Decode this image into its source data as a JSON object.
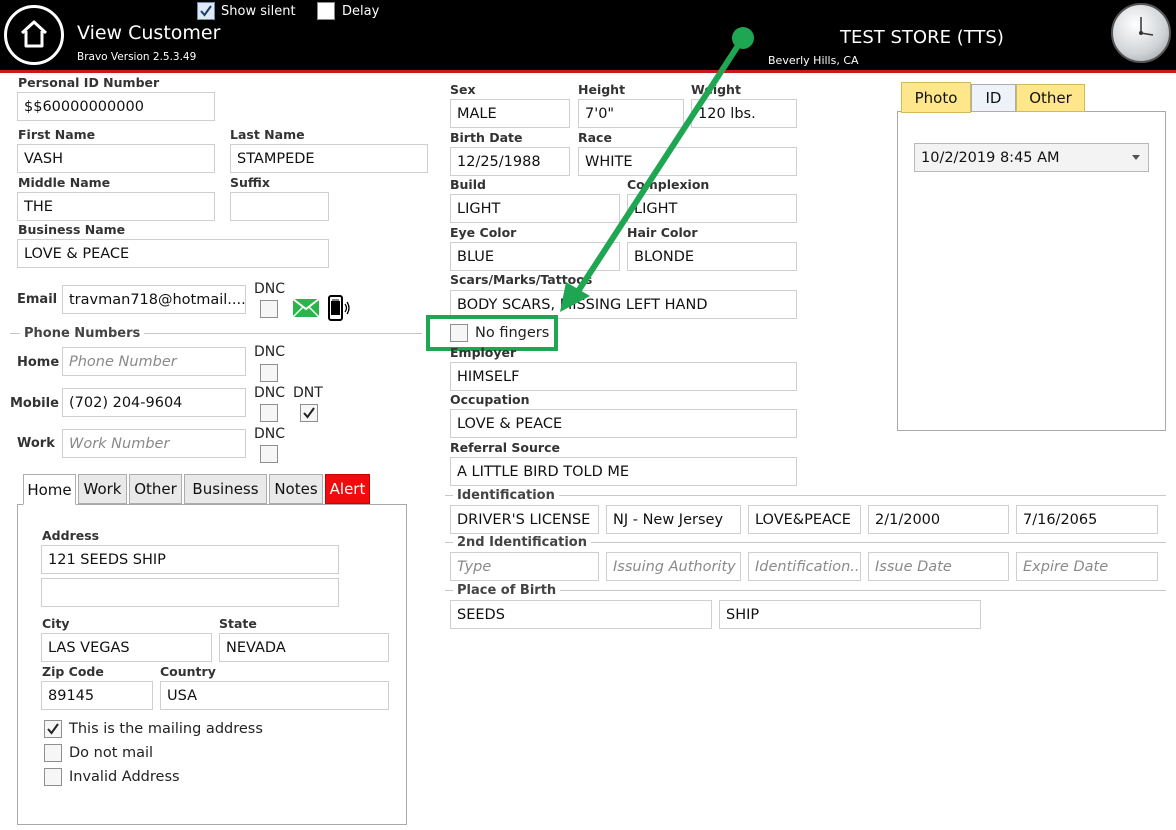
{
  "header": {
    "title": "View Customer",
    "version": "Bravo Version 2.5.3.49",
    "show_silent_label": "Show silent",
    "show_silent_checked": true,
    "delay_label": "Delay",
    "delay_checked": false,
    "store_name": "TEST STORE (TTS)",
    "store_location": "Beverly Hills, CA"
  },
  "personal": {
    "pid_label": "Personal ID Number",
    "pid": "$$60000000000",
    "first_label": "First Name",
    "first": "VASH",
    "last_label": "Last Name",
    "last": "STAMPEDE",
    "middle_label": "Middle Name",
    "middle": "THE",
    "suffix_label": "Suffix",
    "suffix": "",
    "business_label": "Business Name",
    "business": "LOVE & PEACE",
    "email_label": "Email",
    "email": "travman718@hotmail....",
    "dnc_label": "DNC",
    "dnt_label": "DNT"
  },
  "phones": {
    "section_label": "Phone Numbers",
    "home_label": "Home",
    "home_placeholder": "Phone Number",
    "mobile_label": "Mobile",
    "mobile": "(702) 204-9604",
    "work_label": "Work",
    "work_placeholder": "Work Number"
  },
  "address_tabs": [
    "Home",
    "Work",
    "Other",
    "Business",
    "Notes",
    "Alert"
  ],
  "address": {
    "address_label": "Address",
    "line1": "121 SEEDS SHIP",
    "line2": "",
    "city_label": "City",
    "city": "LAS VEGAS",
    "state_label": "State",
    "state": "NEVADA",
    "zip_label": "Zip Code",
    "zip": "89145",
    "country_label": "Country",
    "country": "USA",
    "mailing_label": "This is the mailing address",
    "mailing_checked": true,
    "donotmail_label": "Do not mail",
    "donotmail_checked": false,
    "invalid_label": "Invalid Address",
    "invalid_checked": false
  },
  "physical": {
    "sex_label": "Sex",
    "sex": "MALE",
    "height_label": "Height",
    "height": "7'0\"",
    "weight_label": "Weight",
    "weight": "120 lbs.",
    "birth_label": "Birth Date",
    "birth": "12/25/1988",
    "race_label": "Race",
    "race": "WHITE",
    "build_label": "Build",
    "build": "LIGHT",
    "complexion_label": "Complexion",
    "complexion": "LIGHT",
    "eye_label": "Eye Color",
    "eye": "BLUE",
    "hair_label": "Hair Color",
    "hair": "BLONDE",
    "scars_label": "Scars/Marks/Tattoos",
    "scars": "BODY SCARS, MISSING LEFT HAND",
    "no_fingers_label": "No fingers",
    "no_fingers_checked": false
  },
  "work": {
    "employer_label": "Employer",
    "employer": "HIMSELF",
    "occupation_label": "Occupation",
    "occupation": "LOVE & PEACE",
    "referral_label": "Referral Source",
    "referral": "A LITTLE BIRD TOLD ME"
  },
  "identification": {
    "section_label": "Identification",
    "type": "DRIVER'S LICENSE",
    "authority": "NJ - New Jersey",
    "number": "LOVE&PEACE",
    "issue": "2/1/2000",
    "expire": "7/16/2065"
  },
  "identification2": {
    "section_label": "2nd Identification",
    "type_ph": "Type",
    "authority_ph": "Issuing Authority",
    "number_ph": "Identification...",
    "issue_ph": "Issue Date",
    "expire_ph": "Expire Date"
  },
  "birthplace": {
    "section_label": "Place of Birth",
    "city": "SEEDS",
    "state": "SHIP"
  },
  "photo_tabs": [
    "Photo",
    "ID",
    "Other"
  ],
  "photo": {
    "selected": "10/2/2019 8:45 AM"
  },
  "colors": {
    "header_bg": "#000000",
    "accent_red": "#c81818",
    "alert_tab": "#f00c0c",
    "annotation_green": "#1fa652",
    "tab_yellow": "#fde78a"
  }
}
